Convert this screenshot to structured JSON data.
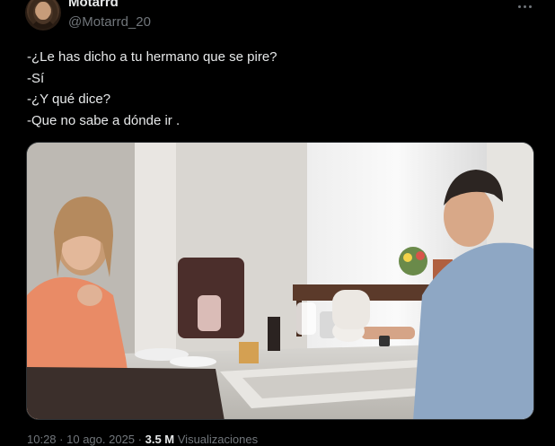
{
  "author": {
    "display_name": "Motarrd",
    "handle": "@Motarrd_20"
  },
  "tweet": {
    "lines": [
      "-¿Le has dicho a tu hermano que se pire?",
      "-Sí",
      "-¿Y qué dice?",
      "-Que no sabe a dónde ir ."
    ]
  },
  "meta": {
    "time": "10:28",
    "date": "10 ago. 2025",
    "views_count": "3.5 M",
    "views_label": "Visualizaciones"
  },
  "icons": {
    "more": "more-horizontal-icon",
    "avatar": "user-avatar"
  }
}
